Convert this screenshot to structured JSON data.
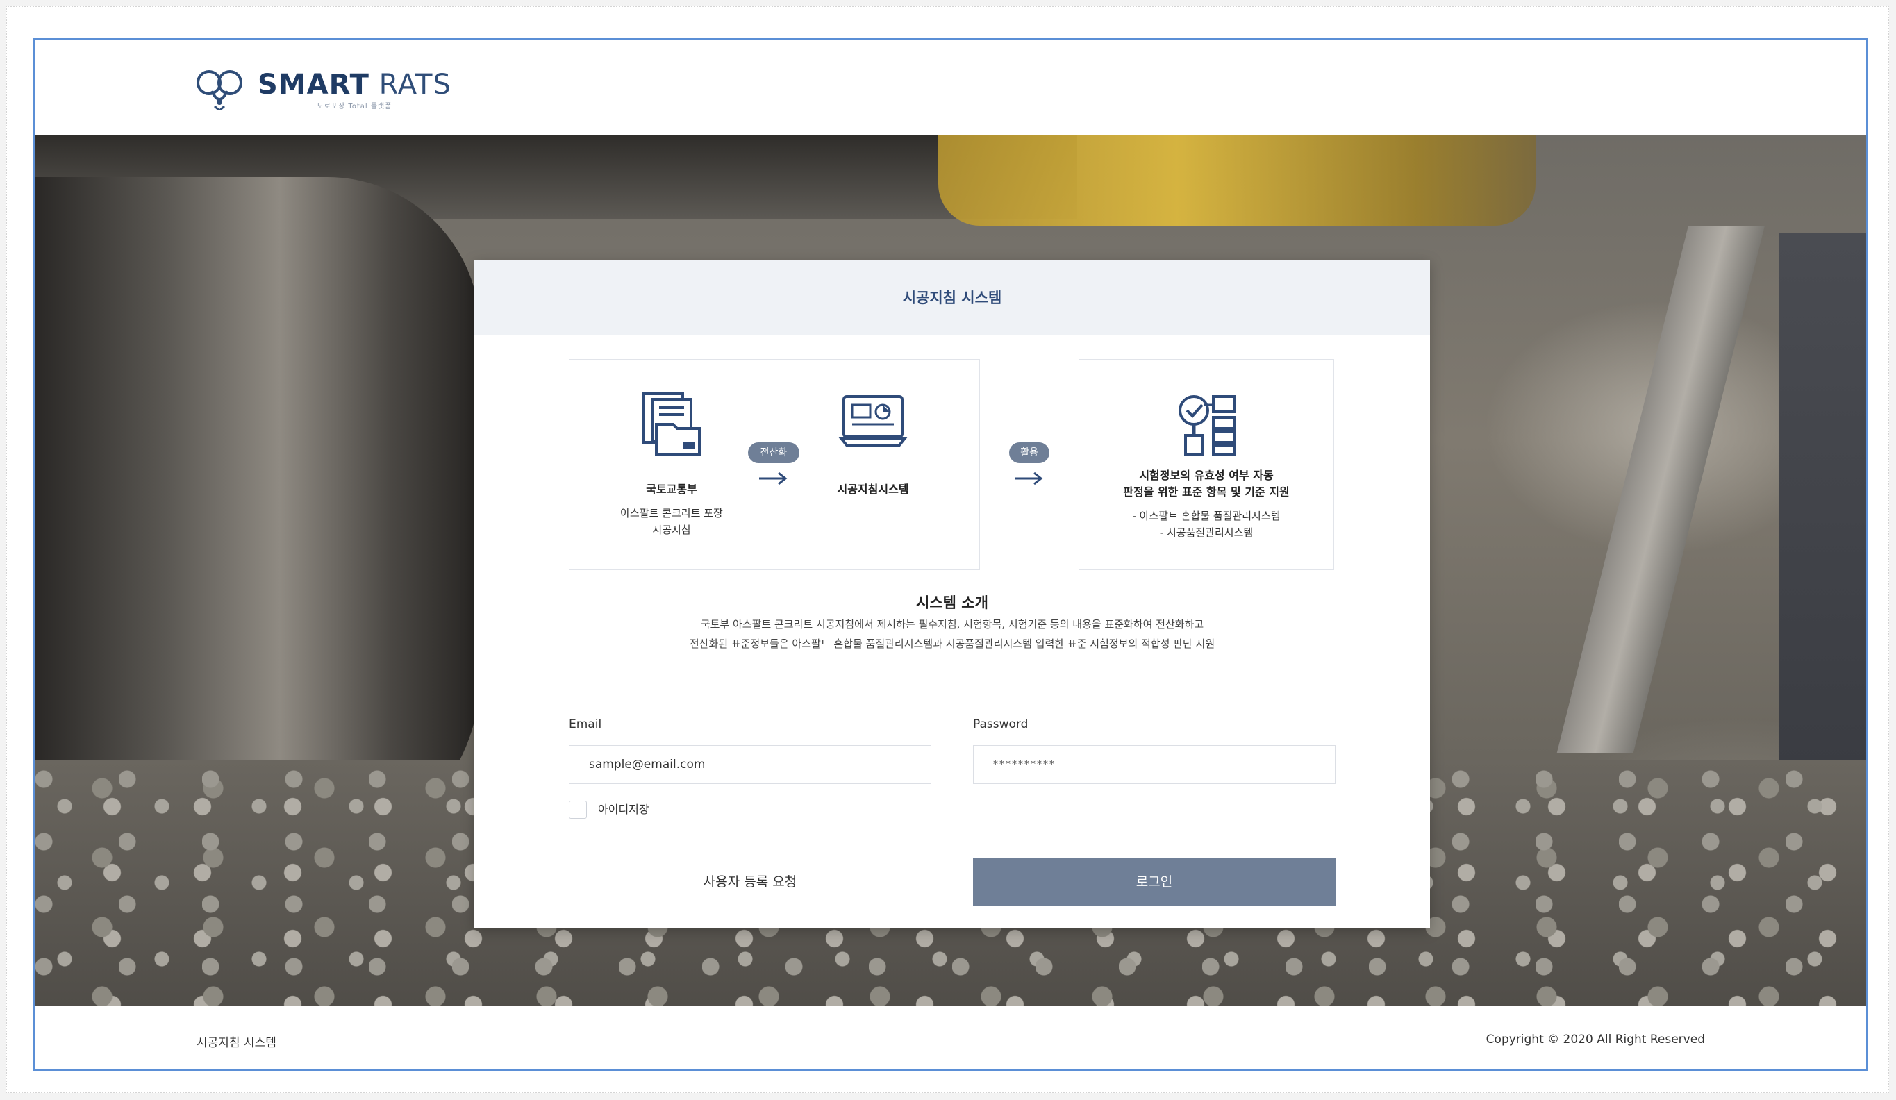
{
  "brand": {
    "logo_text_bold": "SMART",
    "logo_text_light": " RATS",
    "logo_sub": "도로포장 Total 플랫폼"
  },
  "card": {
    "title": "시공지침 시스템",
    "flow": {
      "source_title": "국토교통부",
      "source_desc_1": "아스팔트 콘크리트 포장",
      "source_desc_2": "시공지침",
      "chip_1": "전산화",
      "system_title": "시공지침시스템",
      "chip_2": "활용",
      "target_title_1": "시험정보의 유효성 여부 자동",
      "target_title_2": "판정을 위한 표준 항목 및 기준 지원",
      "target_desc_1": "- 아스팔트 혼합물 품질관리시스템",
      "target_desc_2": "- 시공품질관리시스템"
    },
    "intro": {
      "title": "시스템 소개",
      "line_1": "국토부 아스팔트 콘크리트 시공지침에서 제시하는 필수지침, 시험항목, 시험기준 등의 내용을 표준화하여 전산화하고",
      "line_2": "전산화된 표준정보들은 아스팔트 혼합물 품질관리시스템과 시공품질관리시스템 입력한 표준 시험정보의 적합성 판단 지원"
    },
    "form": {
      "email_label": "Email",
      "email_value": "sample@email.com",
      "password_label": "Password",
      "password_value": "**********",
      "remember_label": "아이디저장",
      "remember_checked": false,
      "register_button": "사용자 등록 요청",
      "login_button": "로그인"
    }
  },
  "footer": {
    "left": "시공지침 시스템",
    "right": "Copyright © 2020  All Right Reserved"
  },
  "colors": {
    "accent": "#2f4b79",
    "button_primary": "#6f7f97",
    "header_bg": "#eff2f6",
    "frame_border": "#5b8fd6"
  },
  "icons": [
    "document-folder-icon",
    "monitor-dashboard-icon",
    "search-check-server-icon",
    "arrow-right-icon"
  ]
}
